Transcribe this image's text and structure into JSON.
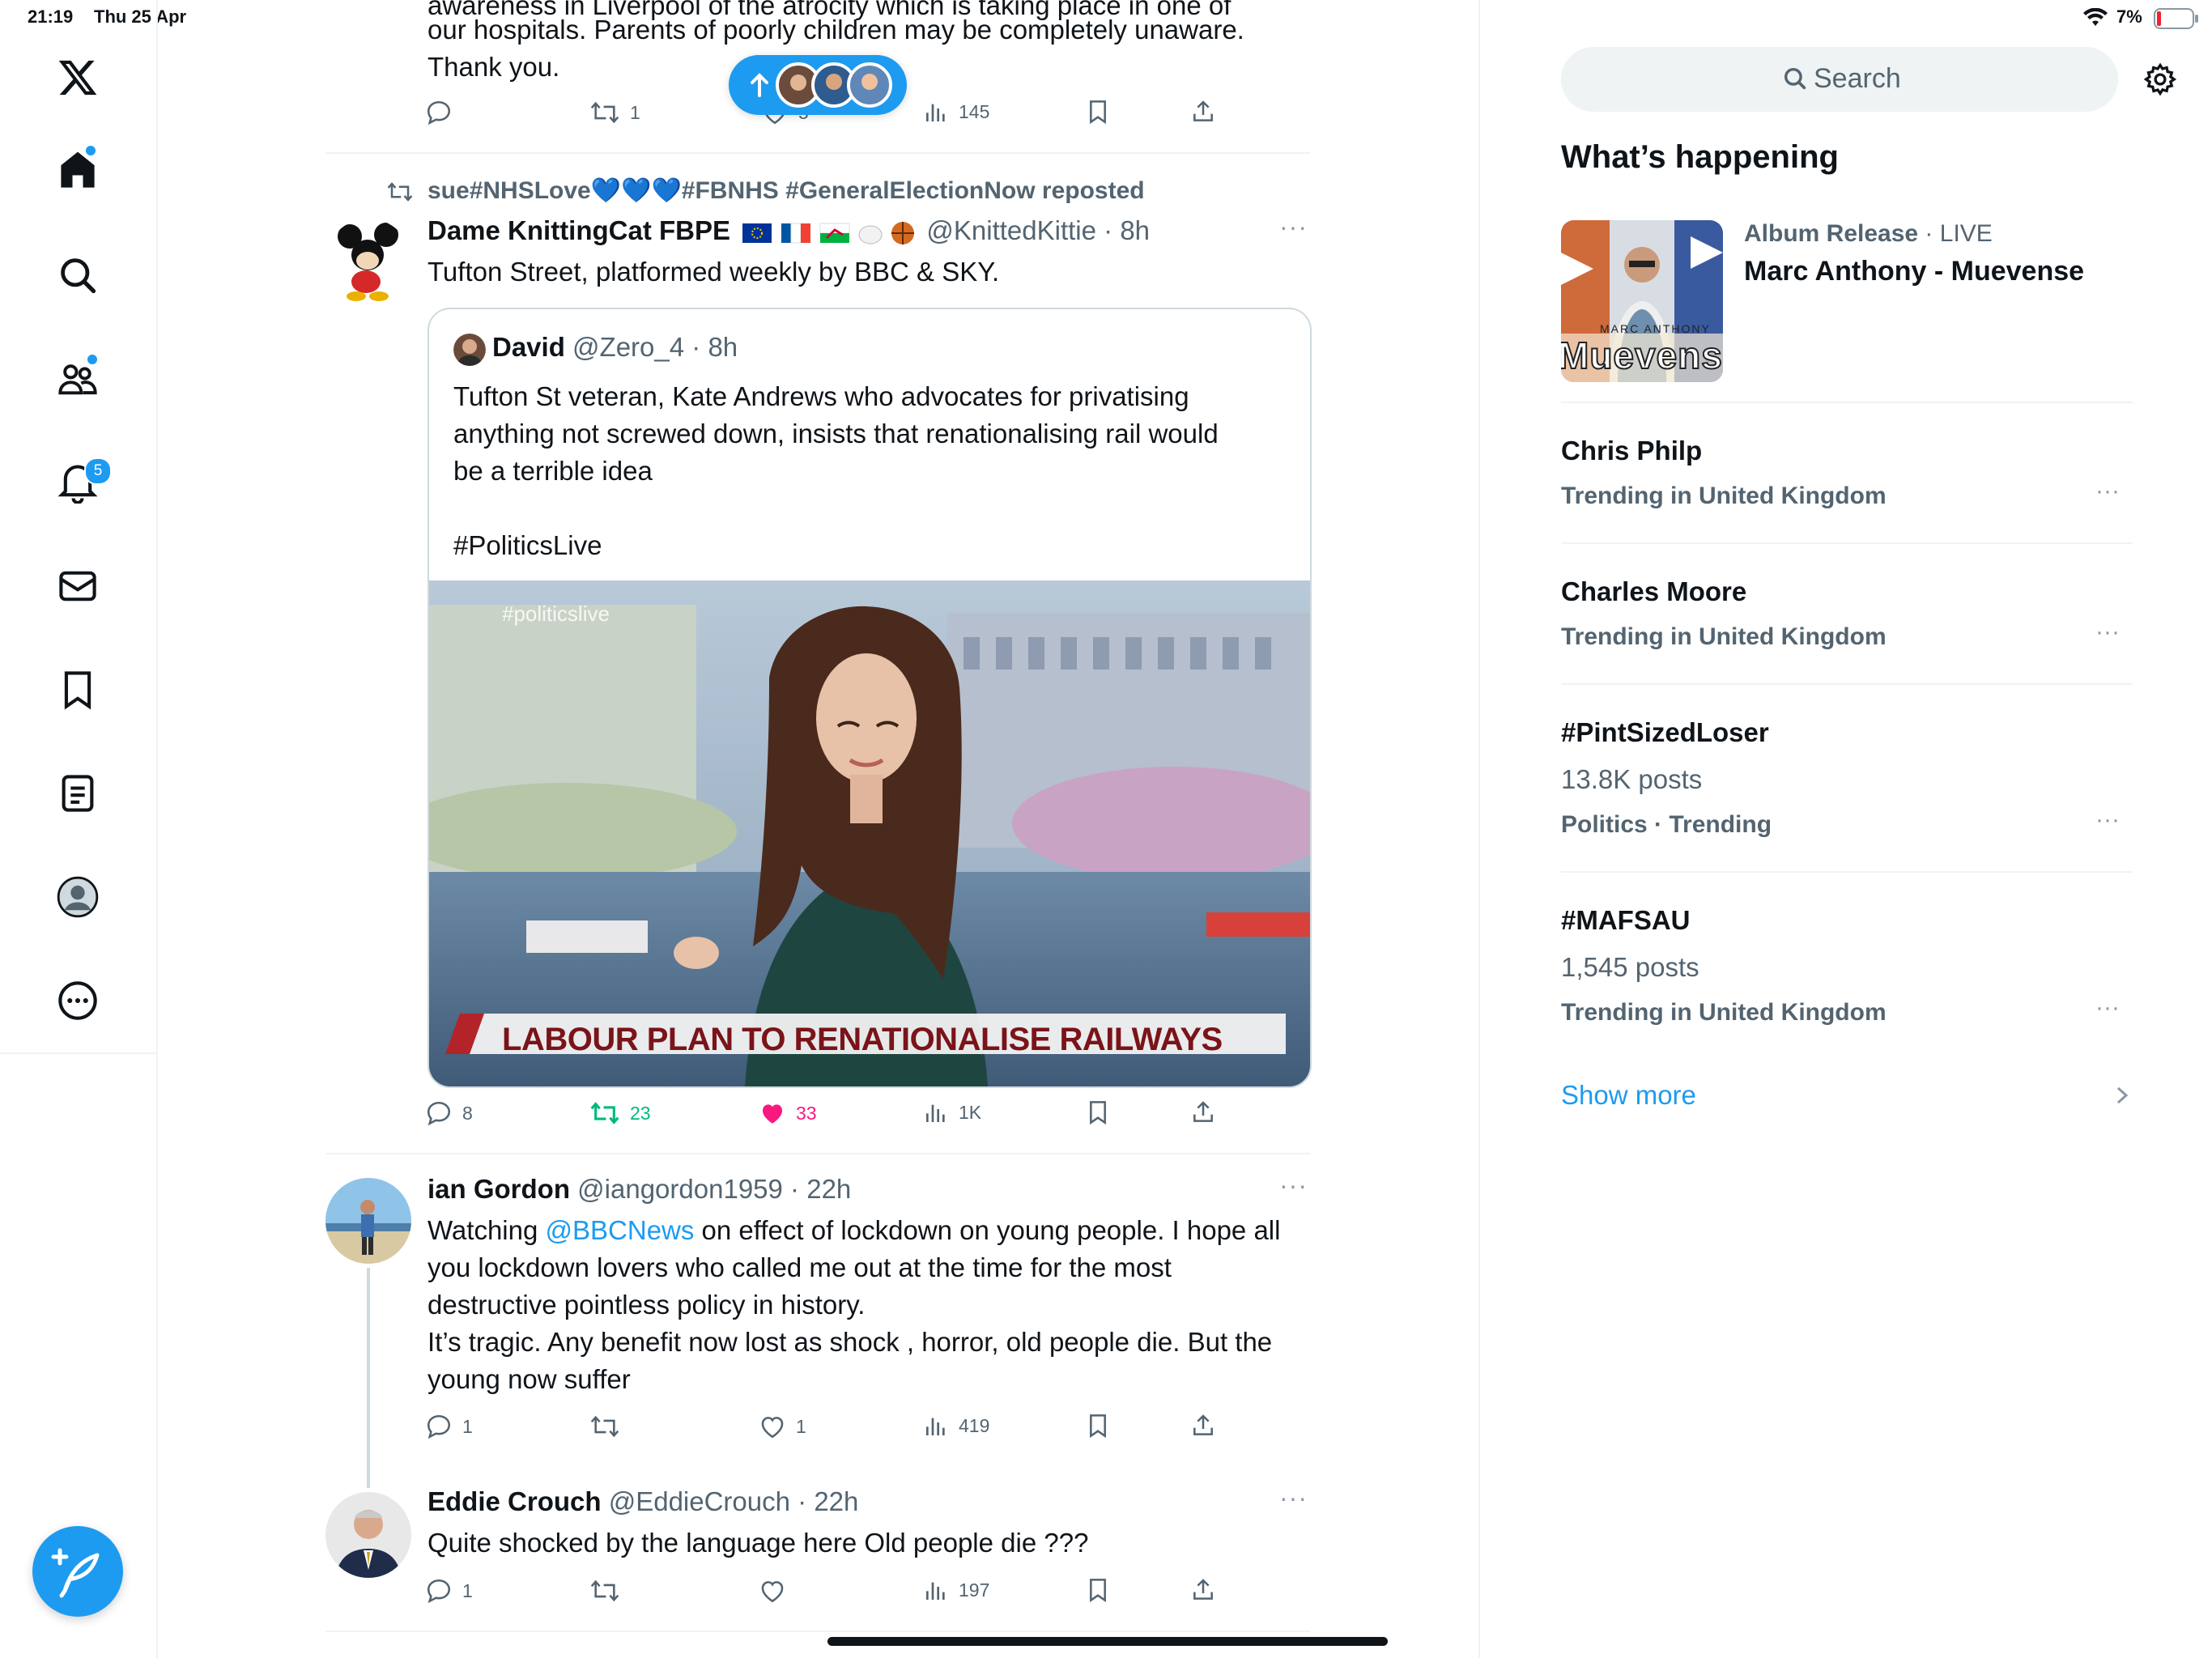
{
  "status_bar": {
    "time": "21:19",
    "date": "Thu 25 Apr",
    "battery": "7%"
  },
  "nav": {
    "items": [
      "home",
      "explore",
      "communities",
      "notifications",
      "messages",
      "bookmarks",
      "lists",
      "profile",
      "more"
    ],
    "notification_count": "5"
  },
  "new_posts_pill": {
    "avatars": 3
  },
  "top_post": {
    "line0": "awareness in Liverpool of the atrocity which is taking place in one of",
    "line1": "our hospitals.  Parents of poorly children may be completely unaware.",
    "line2": "Thank you.",
    "retweets": "1",
    "likes": "5",
    "views": "145"
  },
  "post1": {
    "repost_by": "sue#NHSLove💙💙💙#FBNHS #GeneralElectionNow reposted",
    "name": "Dame KnittingCat FBPE",
    "handle": "@KnittedKittie",
    "time": "8h",
    "text": "Tufton Street, platformed weekly by BBC & SKY.",
    "quote": {
      "name": "David",
      "handle": "@Zero_4",
      "time": "8h",
      "line1": "Tufton St veteran, Kate Andrews who advocates for privatising",
      "line2": "anything not screwed down, insists that renationalising rail would",
      "line3": "be a terrible idea",
      "hashtag": "#PoliticsLive",
      "media_tag": "#politicslive",
      "media_caption": "LABOUR PLAN TO RENATIONALISE RAILWAYS"
    },
    "replies": "8",
    "retweets": "23",
    "likes": "33",
    "views": "1K"
  },
  "post2": {
    "name": "ian Gordon",
    "handle": "@iangordon1959",
    "time": "22h",
    "text_pre": "Watching ",
    "mention": "@BBCNews",
    "line1_rest": " on effect of lockdown on young people. I hope all",
    "line2": "you lockdown lovers who called me out at the time for the most",
    "line3": "destructive pointless policy in history.",
    "line4": "It’s tragic. Any benefit now lost as shock , horror, old people die. But the",
    "line5": "young now suffer",
    "replies": "1",
    "likes": "1",
    "views": "419"
  },
  "post3": {
    "name": "Eddie Crouch",
    "handle": "@EddieCrouch",
    "time": "22h",
    "text": "Quite shocked by the language here Old people die ???",
    "replies": "1",
    "views": "197"
  },
  "search": {
    "placeholder": "Search"
  },
  "whats_happening": {
    "title": "What’s happening",
    "album": {
      "category": "Album Release",
      "live": "LIVE",
      "title": "Marc Anthony - Muevense",
      "cover_text": "Muevense",
      "cover_small": "MARC ANTHONY"
    },
    "trends": [
      {
        "name": "Chris Philp",
        "context": "Trending in United Kingdom",
        "count": ""
      },
      {
        "name": "Charles Moore",
        "context": "Trending in United Kingdom",
        "count": ""
      },
      {
        "name": "#PintSizedLoser",
        "count": "13.8K posts",
        "context": "Politics · Trending"
      },
      {
        "name": "#MAFSAU",
        "count": "1,545 posts",
        "context": "Trending in United Kingdom"
      }
    ],
    "show_more": "Show more"
  },
  "colors": {
    "accent": "#1d9bf0",
    "like": "#f91880",
    "retweet": "#00ba7c",
    "text": "#0f1419",
    "muted": "#536471"
  }
}
